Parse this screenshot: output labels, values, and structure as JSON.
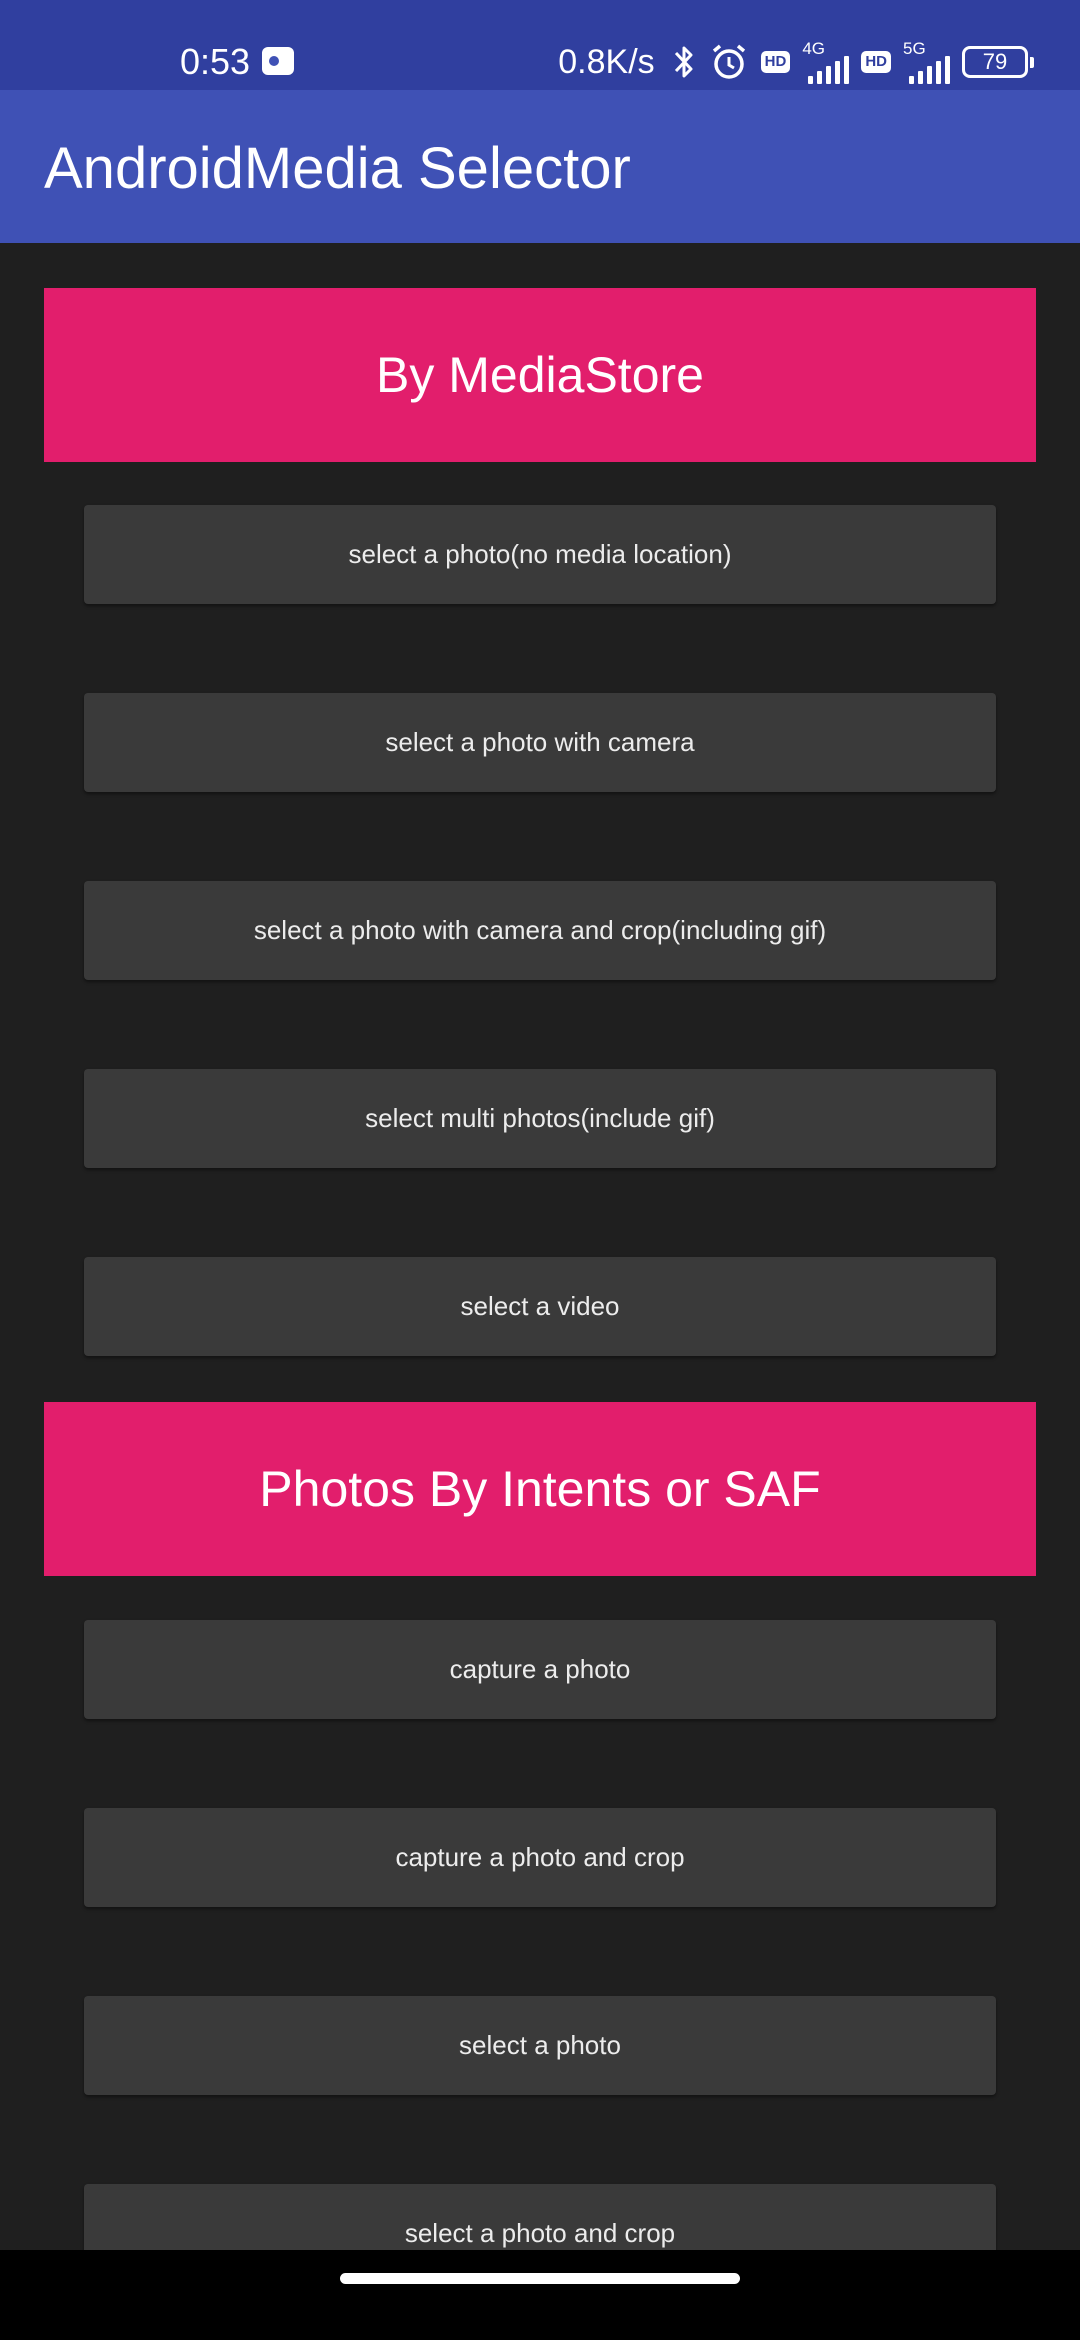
{
  "status_bar": {
    "time": "0:53",
    "net_speed": "0.8K/s",
    "sim1": {
      "hd": "HD",
      "network": "4G"
    },
    "sim2": {
      "hd": "HD",
      "network": "5G"
    },
    "battery": "79",
    "icons": [
      "app-notification-icon",
      "bluetooth-icon",
      "alarm-icon",
      "signal-icon",
      "battery-icon"
    ]
  },
  "app_bar": {
    "title": "AndroidMedia Selector",
    "color": "#3f51b5"
  },
  "sections": [
    {
      "header": "By MediaStore",
      "buttons": [
        "select a photo(no media location)",
        "select a photo with camera",
        "select a photo with camera and crop(including gif)",
        "select multi photos(include gif)",
        "select a video"
      ]
    },
    {
      "header": "Photos By Intents or SAF",
      "buttons": [
        "capture a photo",
        "capture a photo and crop",
        "select a photo",
        "select a photo and crop"
      ]
    }
  ],
  "colors": {
    "status_bar": "#303f9f",
    "header": "#e21e6c",
    "button": "#3a3a3a",
    "background": "#1f1f1f"
  }
}
